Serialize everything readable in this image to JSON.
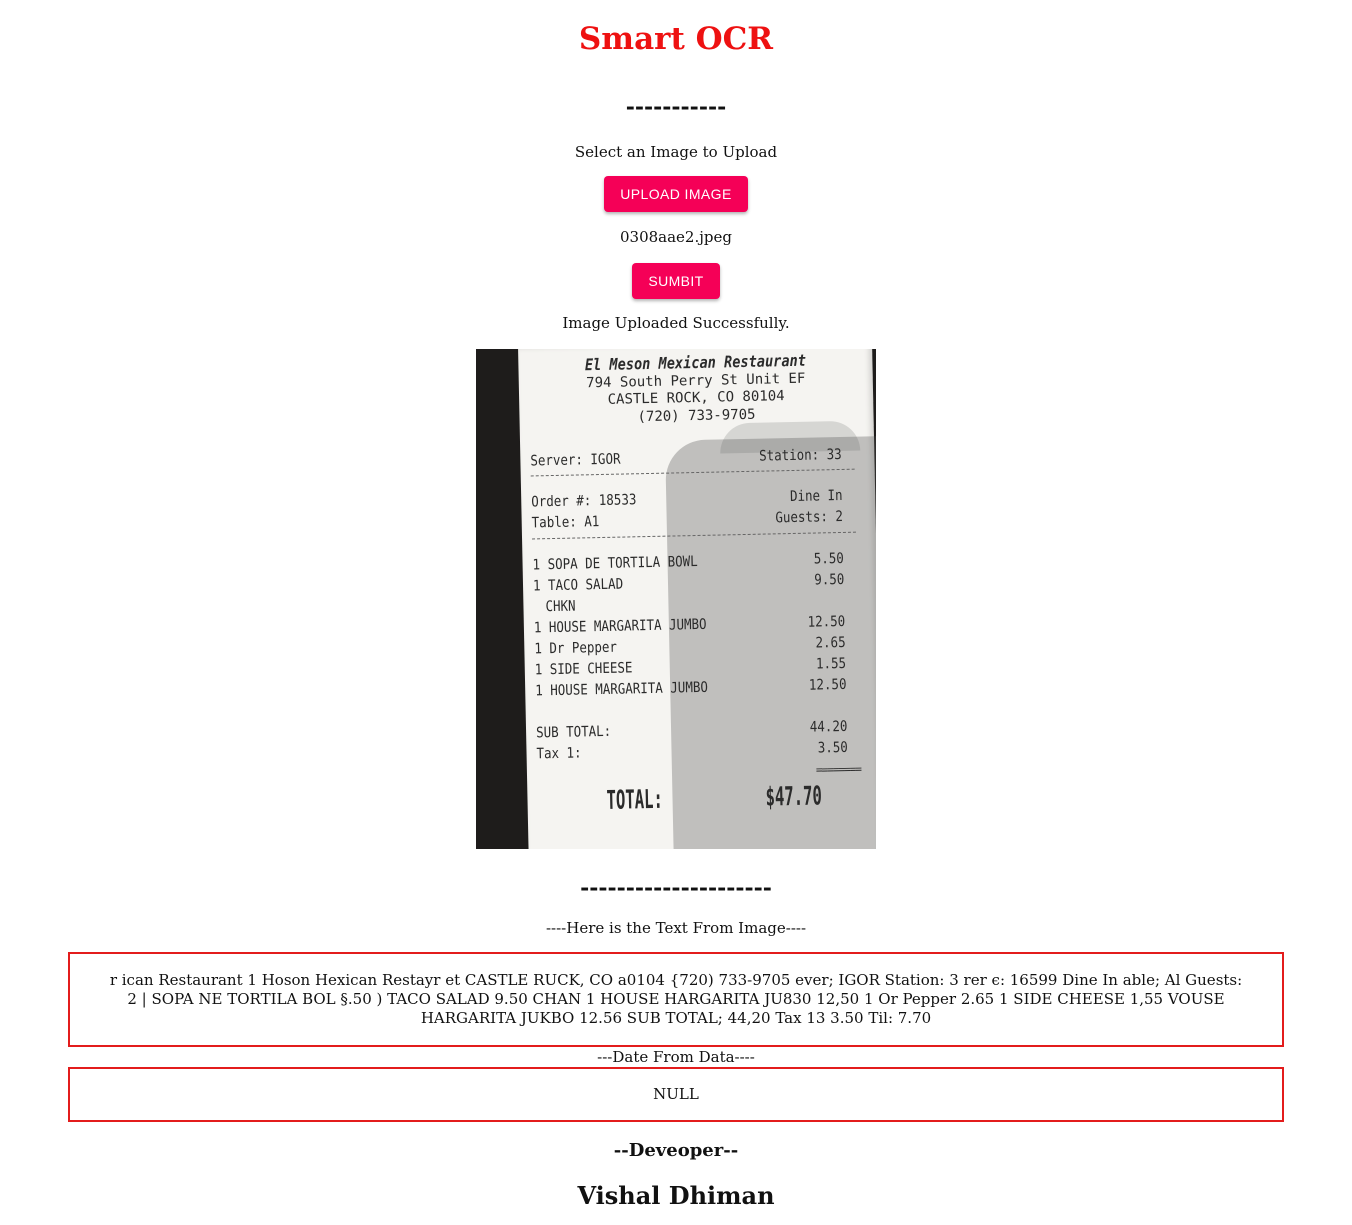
{
  "app": {
    "title": "Smart OCR",
    "divider_top": "-----------",
    "upload_prompt": "Select an Image to Upload",
    "upload_button": "UPLOAD IMAGE",
    "filename": "0308aae2.jpeg",
    "submit_button": "SUMBIT",
    "status": "Image Uploaded Successfully.",
    "divider_bottom": "---------------------",
    "brand_color": "#f50057",
    "title_color": "#ee1111",
    "box_border_color": "#e31c1c"
  },
  "receipt": {
    "restaurant": "El Meson Mexican Restaurant",
    "address1": "794 South Perry St Unit EF",
    "address2": "CASTLE ROCK, CO 80104",
    "phone": "(720) 733-9705",
    "server": "Server: IGOR",
    "station": "Station: 33",
    "order": "Order #: 18533",
    "dine": "Dine In",
    "table": "Table: A1",
    "guests": "Guests: 2",
    "items": [
      {
        "name": "1 SOPA DE TORTILA BOWL",
        "price": "5.50"
      },
      {
        "name": "1 TACO SALAD",
        "price": "9.50"
      },
      {
        "name": "  CHKN",
        "price": ""
      },
      {
        "name": "1 HOUSE MARGARITA JUMBO",
        "price": "12.50"
      },
      {
        "name": "1 Dr Pepper",
        "price": "2.65"
      },
      {
        "name": "1 SIDE CHEESE",
        "price": "1.55"
      },
      {
        "name": "1 HOUSE MARGARITA JUMBO",
        "price": "12.50"
      }
    ],
    "subtotal_label": "SUB TOTAL:",
    "subtotal": "44.20",
    "tax_label": "Tax 1:",
    "tax": "3.50",
    "equals": "========",
    "total_label": "TOTAL:",
    "total": "$47.70"
  },
  "ocr": {
    "heading": "----Here is the Text From Image----",
    "text": "r ican Restaurant 1 Hoson Hexican Restayr et CASTLE RUCK, CO a0104 {720) 733-9705 ever; IGOR Station: 3 rer є: 16599 Dine In able; Al Guests: 2 | SOPA NE TORTILA BOL §.50 ) TACO SALAD 9.50 CHAN 1 HOUSE HARGARITA JU830 12,50 1 Or Pepper 2.65 1 SIDE CHEESE 1,55 VOUSE HARGARITA JUKBO 12.56 SUB TOTAL; 44,20 Tax 13 3.50 Til: 7.70",
    "date_heading": "---Date From Data----",
    "date_value": "NULL"
  },
  "developer": {
    "heading": "--Deveoper--",
    "name": "Vishal Dhiman"
  }
}
